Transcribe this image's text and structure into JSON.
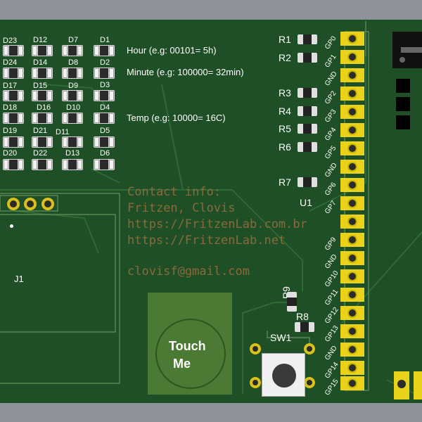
{
  "leds": [
    "D23",
    "D12",
    "D7",
    "D1",
    "D24",
    "D14",
    "D8",
    "D2",
    "D17",
    "D15",
    "D9",
    "D3",
    "D18",
    "D16",
    "D10",
    "D4",
    "D19",
    "D21",
    "D11",
    "D5",
    "D20",
    "D22",
    "D13",
    "D6"
  ],
  "info": {
    "hour": "Hour (e.g: 00101= 5h)",
    "minute": "Minute (e.g: 100000= 32min)",
    "temp": "Temp (e.g: 10000= 16C)"
  },
  "fab": {
    "line1": "Contact info:",
    "line2": "Fritzen, Clovis",
    "line3": "https://FritzenLab.com.br",
    "line4": "https://FritzenLab.net",
    "line5": "clovisf@gmail.com"
  },
  "resistors": [
    "R1",
    "R2",
    "R3",
    "R4",
    "R5",
    "R6",
    "R7",
    "R8",
    "R9"
  ],
  "u1": "U1",
  "j1": "J1",
  "sw1": "SW1",
  "touch": {
    "line1": "Touch",
    "line2": "Me"
  },
  "pins": [
    "GP0",
    "GP1",
    "GND",
    "GP2",
    "GP3",
    "GP4",
    "GP5",
    "GND",
    "GP6",
    "GP7",
    "",
    "GP9",
    "GND",
    "GP10",
    "GP11",
    "GP12",
    "GP13",
    "GND",
    "GP14",
    "GP15"
  ],
  "colors": {
    "board": "#1f4f26",
    "pad": "#e8d21a",
    "silk": "#ffffff",
    "fab": "#8a6a3a"
  }
}
